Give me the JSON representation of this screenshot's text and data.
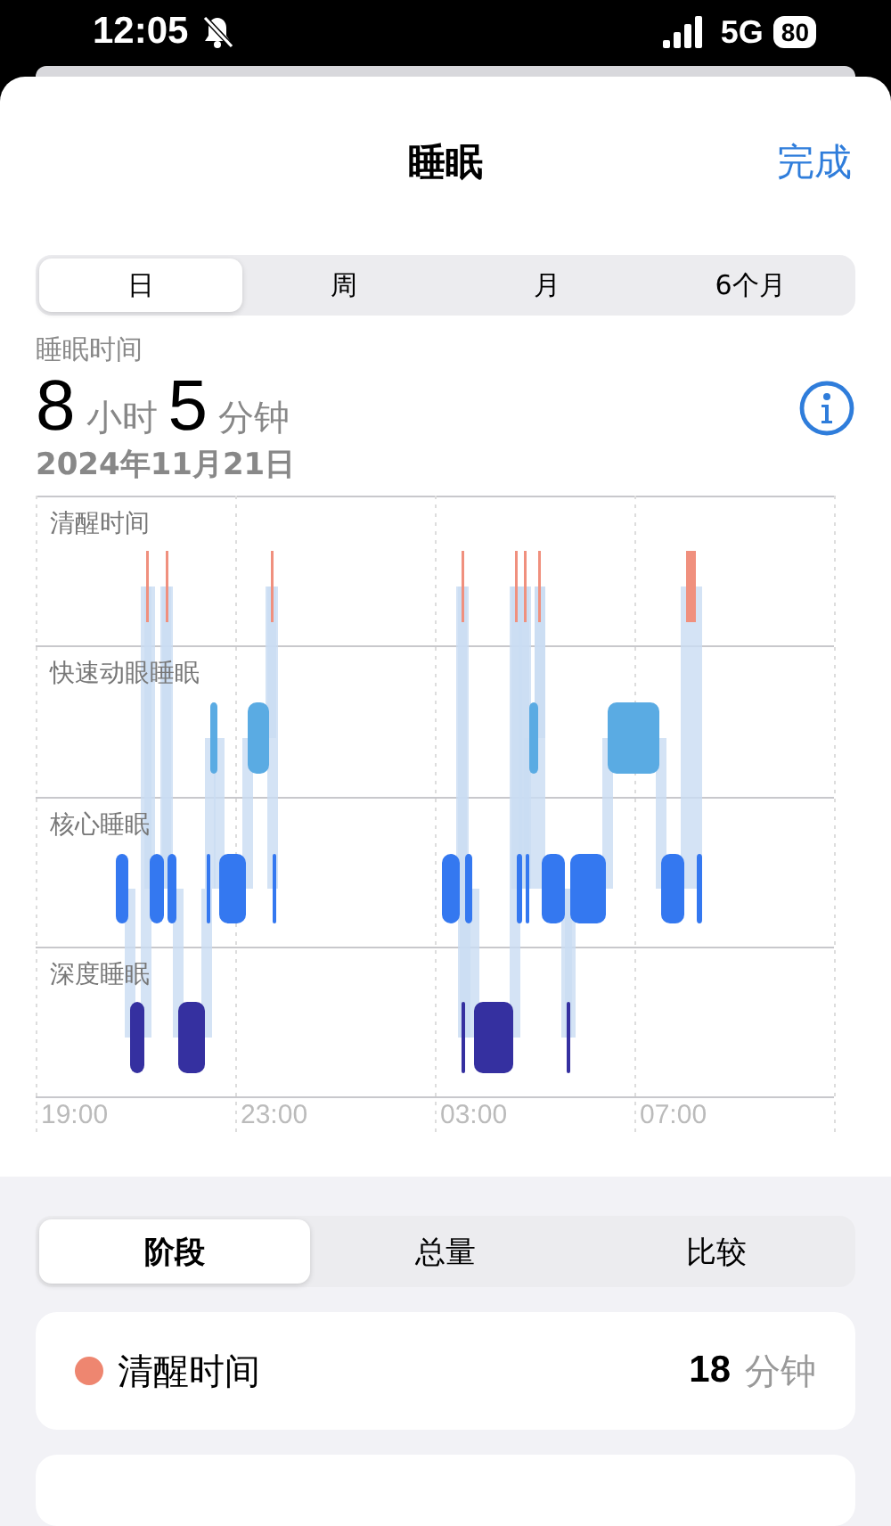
{
  "status_bar": {
    "time": "12:05",
    "network": "5G",
    "battery": "80"
  },
  "header": {
    "title": "睡眠",
    "done": "完成"
  },
  "range_tabs": [
    {
      "label": "日",
      "selected": true
    },
    {
      "label": "周",
      "selected": false
    },
    {
      "label": "月",
      "selected": false
    },
    {
      "label": "6个月",
      "selected": false
    }
  ],
  "summary": {
    "label": "睡眠时间",
    "hours": "8",
    "hours_unit": "小时",
    "minutes": "5",
    "minutes_unit": "分钟",
    "date": "2024年11月21日"
  },
  "chart": {
    "stages": [
      "清醒时间",
      "快速动眼睡眠",
      "核心睡眠",
      "深度睡眠"
    ],
    "times": [
      "19:00",
      "23:00",
      "03:00",
      "07:00"
    ]
  },
  "view_tabs": [
    {
      "label": "阶段",
      "selected": true
    },
    {
      "label": "总量",
      "selected": false
    },
    {
      "label": "比较",
      "selected": false
    }
  ],
  "stage_rows": [
    {
      "name": "清醒时间",
      "color": "#ee8670",
      "value": "18",
      "unit": "分钟"
    }
  ]
}
